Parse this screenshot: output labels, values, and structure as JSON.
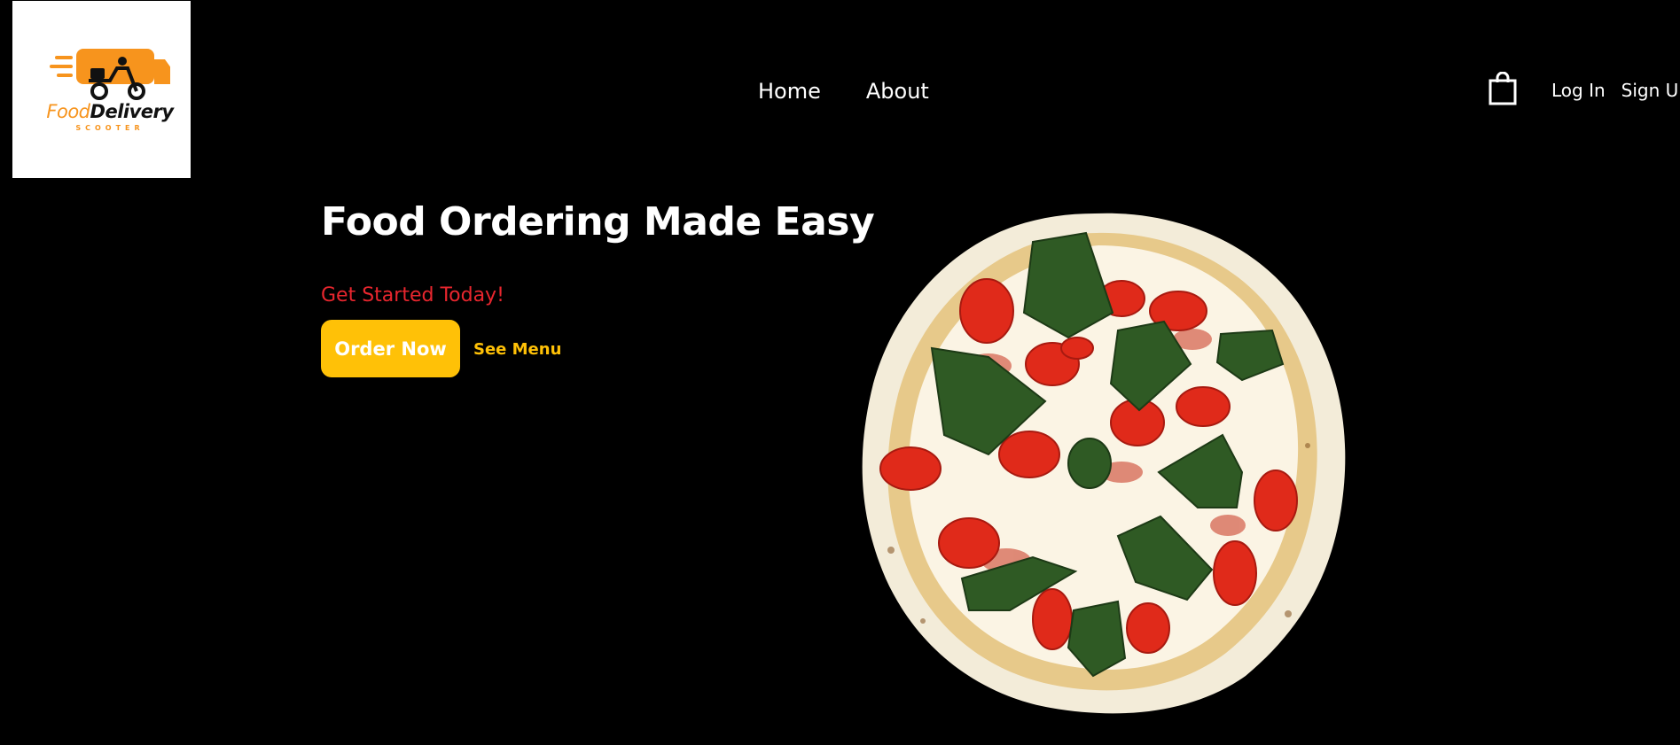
{
  "logo": {
    "word1": "Food",
    "word2": "Delivery",
    "sub": "SCOOTER"
  },
  "nav": {
    "home": "Home",
    "about": "About"
  },
  "auth": {
    "login": "Log In",
    "signup": "Sign Up"
  },
  "hero": {
    "title": "Food Ordering Made Easy",
    "tagline": "Get Started Today!",
    "order_label": "Order Now",
    "menu_label": "See Menu"
  },
  "colors": {
    "background": "#000000",
    "accent": "#ffc107",
    "tagline": "#e8262e",
    "logo_orange": "#f7941d"
  },
  "icons": [
    "scooter-truck-icon",
    "shopping-bag-icon"
  ]
}
